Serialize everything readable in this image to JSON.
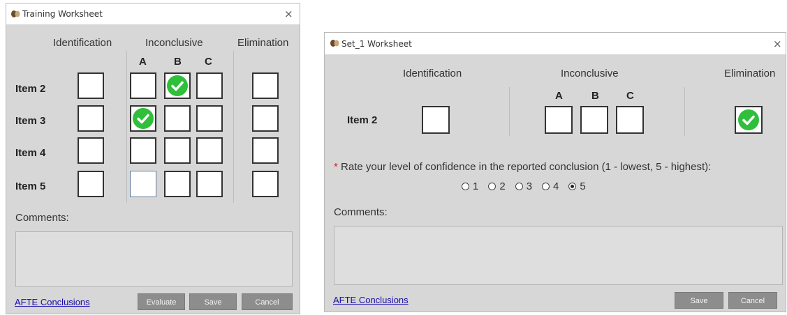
{
  "left": {
    "title": "Training Worksheet",
    "close": "×",
    "headers": {
      "identification": "Identification",
      "inconclusive": "Inconclusive",
      "elimination": "Elimination"
    },
    "sub": {
      "a": "A",
      "b": "B",
      "c": "C"
    },
    "items": [
      "Item 2",
      "Item 3",
      "Item 4",
      "Item 5"
    ],
    "checked": {
      "item2": "Inconclusive B",
      "item3": "Inconclusive A"
    },
    "comments_label": "Comments:",
    "link": "AFTE Conclusions",
    "buttons": {
      "evaluate": "Evaluate",
      "save": "Save",
      "cancel": "Cancel"
    }
  },
  "right": {
    "title": "Set_1 Worksheet",
    "close": "×",
    "headers": {
      "identification": "Identification",
      "inconclusive": "Inconclusive",
      "elimination": "Elimination"
    },
    "sub": {
      "a": "A",
      "b": "B",
      "c": "C"
    },
    "item": "Item 2",
    "checked": "Elimination",
    "required_mark": "*",
    "prompt": "Rate your level of confidence in the reported conclusion (1 - lowest, 5 - highest):",
    "ratings": [
      "1",
      "2",
      "3",
      "4",
      "5"
    ],
    "selected_rating": "5",
    "comments_label": "Comments:",
    "link": "AFTE Conclusions",
    "buttons": {
      "save": "Save",
      "cancel": "Cancel"
    }
  },
  "colors": {
    "check": "#2fbf3a",
    "link": "#1a0dab",
    "button": "#8d8d8d",
    "required": "#d62020"
  }
}
